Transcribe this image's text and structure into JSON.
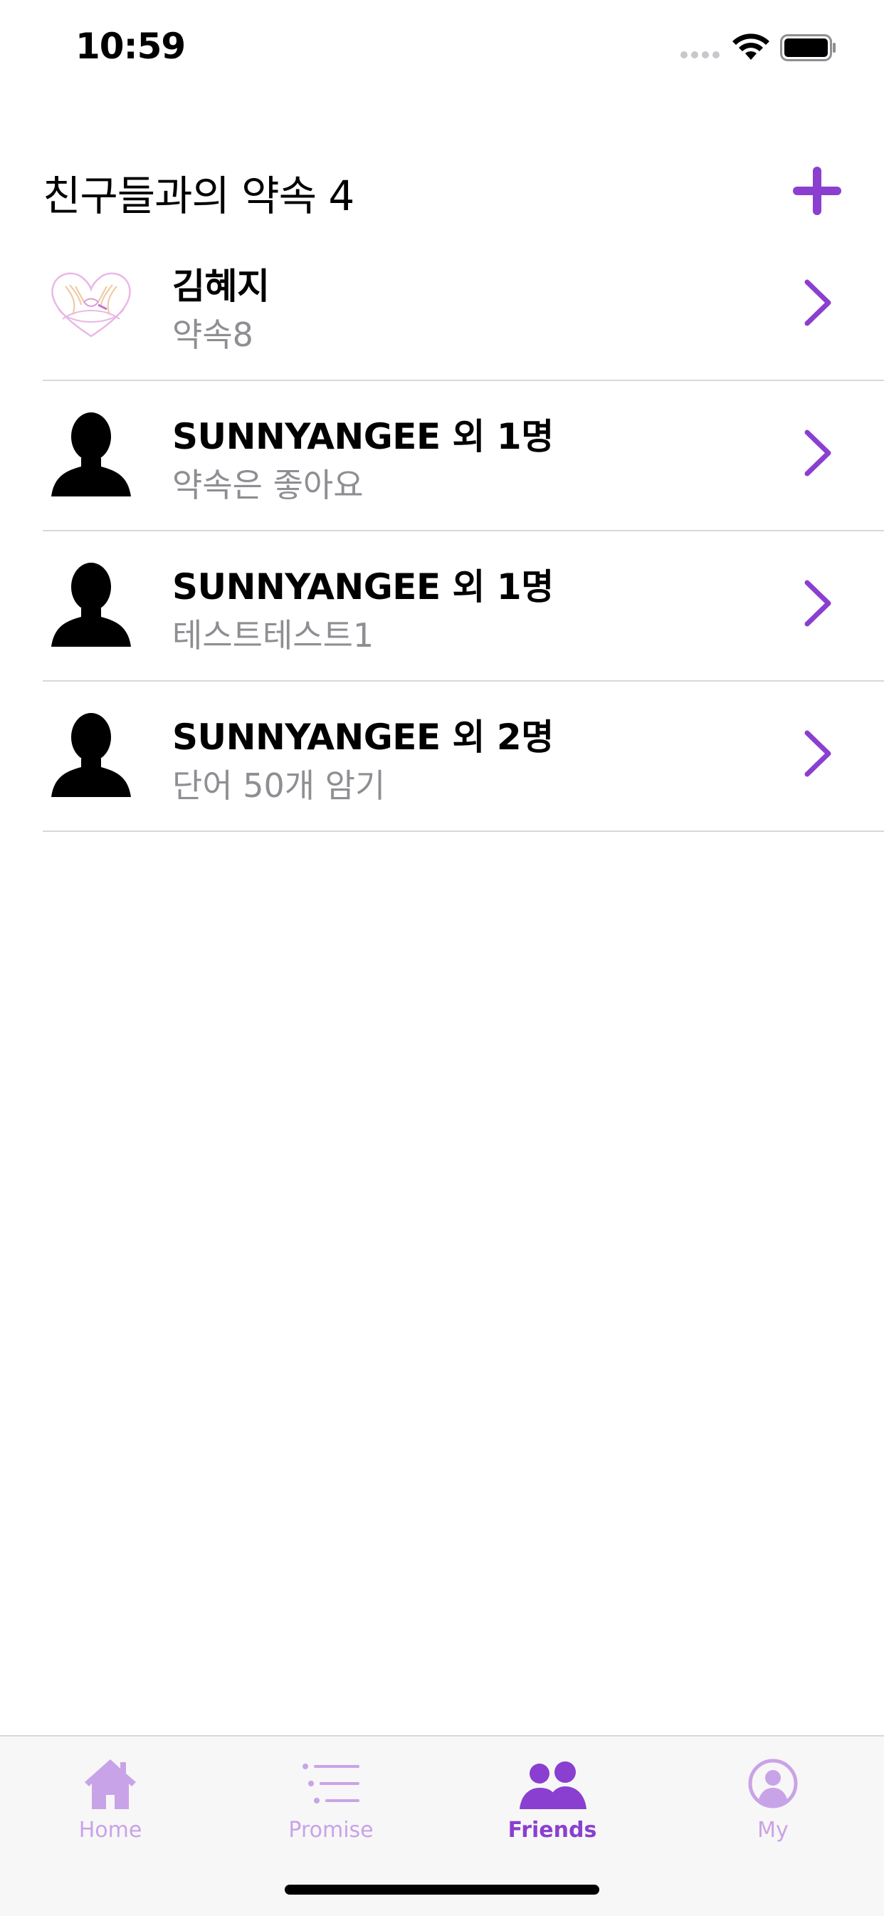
{
  "status_bar": {
    "time": "10:59"
  },
  "header": {
    "title": "친구들과의 약속 4",
    "add_icon": "plus-icon"
  },
  "colors": {
    "accent": "#8a3fd0",
    "accent_light": "#c9a3e8",
    "subtitle": "#8e8e93",
    "divider": "#d8d8dc"
  },
  "promises": [
    {
      "title": "김혜지",
      "subtitle": "약속8",
      "avatar": "pinky-promise-heart-image"
    },
    {
      "title": "SUNNYANGEE 외 1명",
      "subtitle": "약속은 좋아요",
      "avatar": "person-silhouette-icon"
    },
    {
      "title": "SUNNYANGEE 외 1명",
      "subtitle": "테스트테스트1",
      "avatar": "person-silhouette-icon"
    },
    {
      "title": "SUNNYANGEE 외 2명",
      "subtitle": "단어 50개 암기",
      "avatar": "person-silhouette-icon"
    }
  ],
  "tab_bar": {
    "tabs": [
      {
        "label": "Home",
        "icon": "house-icon",
        "active": false
      },
      {
        "label": "Promise",
        "icon": "list-icon",
        "active": false
      },
      {
        "label": "Friends",
        "icon": "two-people-icon",
        "active": true
      },
      {
        "label": "My",
        "icon": "person-circle-icon",
        "active": false
      }
    ]
  }
}
